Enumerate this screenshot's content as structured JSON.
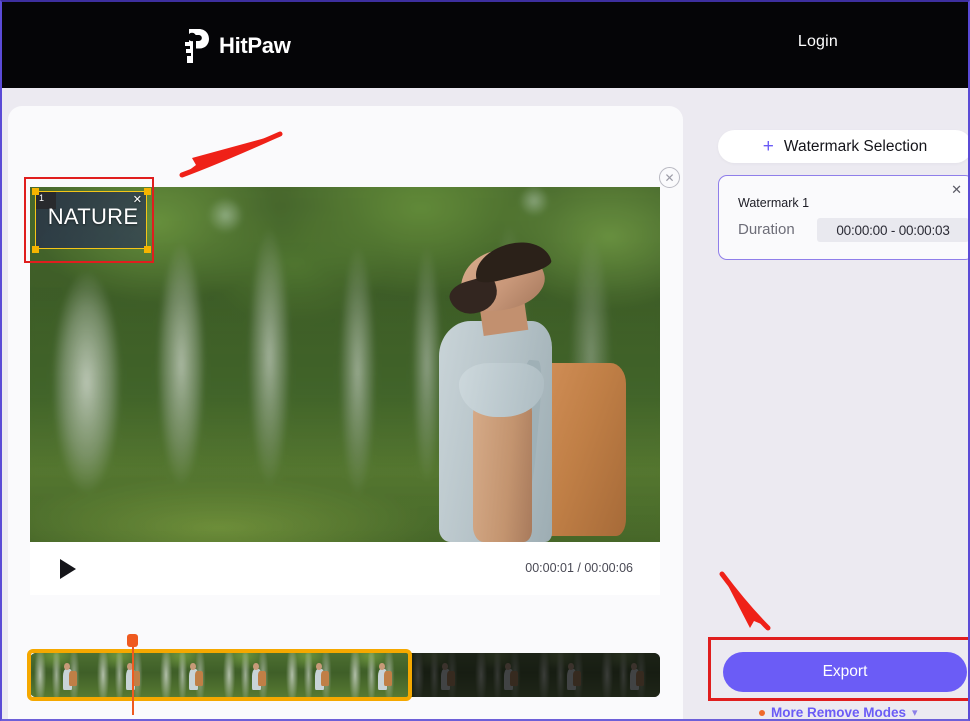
{
  "app": {
    "brand": "HitPaw",
    "login_label": "Login",
    "accent_purple": "#6b5cf6",
    "annotation_red": "#e01e1e",
    "timeline_orange": "#f5a800",
    "playhead_orange": "#ef5a1f"
  },
  "topbar": {
    "logo_icon": "hitpaw-logo-icon",
    "brand": "HitPaw",
    "login_label": "Login"
  },
  "preview": {
    "close_icon": "close-circle-icon",
    "watermark_overlay": {
      "index_badge": "1",
      "text": "NATURE",
      "close_icon": "close-icon",
      "handles": [
        "top-left",
        "top-right",
        "bottom-left",
        "bottom-right"
      ]
    }
  },
  "player": {
    "play_icon": "play-icon",
    "current_time": "00:00:01",
    "total_time": "00:00:06",
    "time_display": "00:00:01 / 00:00:06"
  },
  "timeline": {
    "playhead_position_label": "00:00:01",
    "selection_start": "00:00:00",
    "selection_end": "00:00:03"
  },
  "sidebar": {
    "watermark_selection": {
      "plus_icon": "plus-icon",
      "label": "Watermark Selection"
    },
    "watermark_card": {
      "title": "Watermark 1",
      "close_icon": "close-icon",
      "duration_label": "Duration",
      "duration_value": "00:00:00 - 00:00:03",
      "duration_start": "00:00:00",
      "duration_end": "00:00:03"
    },
    "export": {
      "label": "Export"
    },
    "more_modes": {
      "dot_color": "#f06a2a",
      "label": "More Remove Modes",
      "chevron_icon": "chevron-down-icon"
    }
  },
  "annotations": {
    "arrow_to_watermark": "red-arrow-icon",
    "arrow_to_export": "red-arrow-icon",
    "highlight_watermark_box": "red-highlight-box",
    "highlight_export_button": "red-highlight-box"
  }
}
